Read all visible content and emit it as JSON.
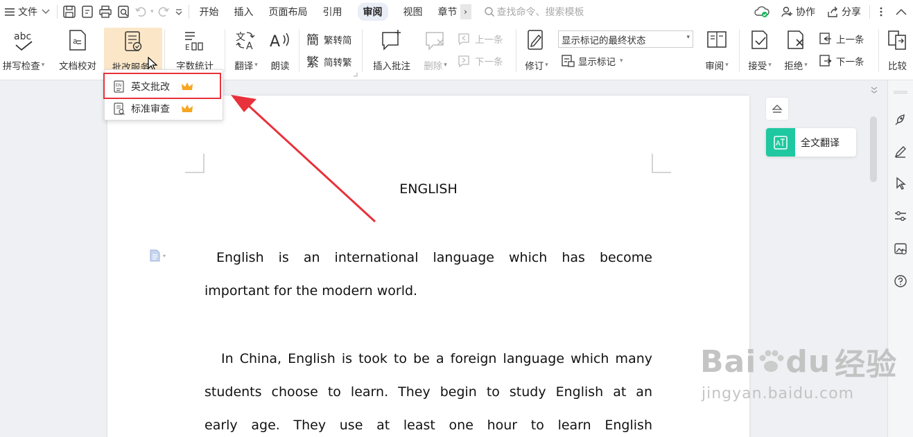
{
  "menubar": {
    "menu_label": "文件",
    "tabs": [
      "开始",
      "插入",
      "页面布局",
      "引用",
      "审阅",
      "视图",
      "章节"
    ],
    "active_tab": "审阅",
    "more": "›",
    "search_placeholder": "查找命令、搜索模板",
    "collab_label": "协作",
    "share_label": "分享"
  },
  "ribbon": {
    "spellcheck": "拼写检查",
    "doc_proof": "文档校对",
    "correction_service": "批改服务",
    "word_count": "字数统计",
    "translate": "翻译",
    "read_aloud": "朗读",
    "trad_to_simp": "繁转简",
    "simp_to_trad": "简转繁",
    "insert_comment": "插入批注",
    "delete": "删除",
    "prev_comment": "上一条",
    "next_comment": "下一条",
    "track_changes": "修订",
    "display_mode": "显示标记的最终状态",
    "show_markup": "显示标记",
    "review_pane": "审阅",
    "accept": "接受",
    "reject": "拒绝",
    "prev_change": "上一条",
    "next_change": "下一条",
    "compare": "比较"
  },
  "dropdown": {
    "items": [
      {
        "label": "英文批改"
      },
      {
        "label": "标准审查"
      }
    ]
  },
  "document": {
    "title": "ENGLISH",
    "paragraphs": [
      [
        "English is an international language which has become",
        "important for the modern world."
      ],
      [
        "In China, English is took to be a foreign language which many",
        "students choose to learn. They begin to study English at an",
        "early age. They use at least one hour to learn English"
      ]
    ]
  },
  "side": {
    "translate_label": "全文翻译"
  },
  "watermark": {
    "main": "Bai",
    "main2": "du",
    "main3": "经验",
    "sub": "jingyan.baidu.com"
  },
  "colors": {
    "highlight": "#e8313a",
    "accent_green": "#1fc8a0",
    "active_button": "#fbe7c8",
    "crown": "#f5a623"
  }
}
